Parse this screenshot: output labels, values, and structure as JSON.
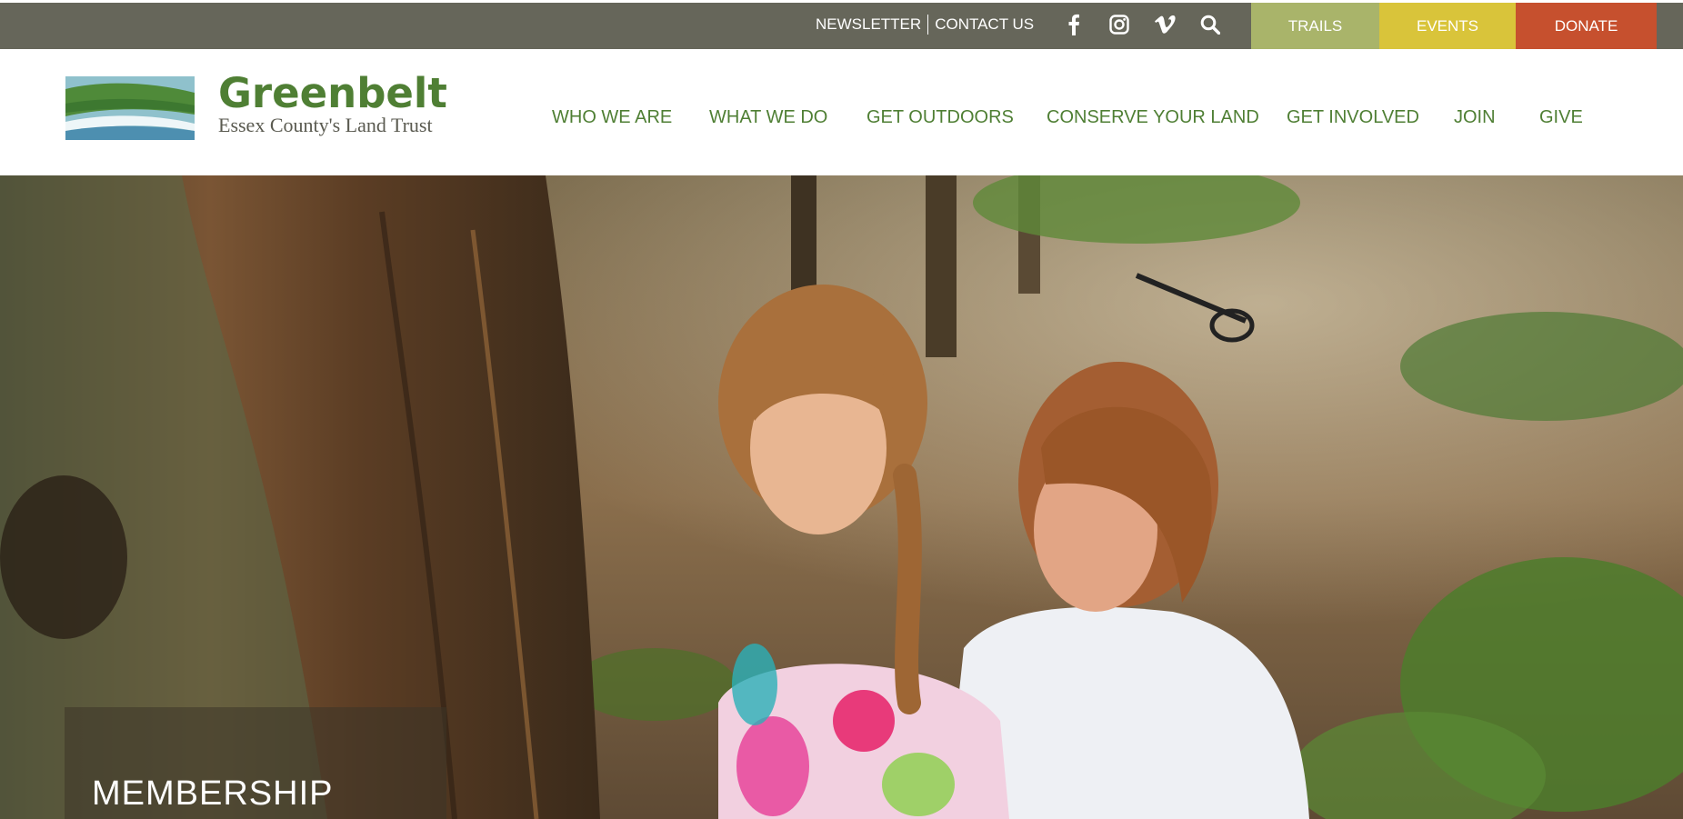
{
  "topbar": {
    "newsletter": "NEWSLETTER",
    "contact": "CONTACT US",
    "social": [
      "facebook-icon",
      "instagram-icon",
      "vimeo-icon",
      "search-icon"
    ],
    "trails": "TRAILS",
    "events": "EVENTS",
    "donate": "DONATE",
    "colors": {
      "bar": "#66665a",
      "trails": "#a9b46a",
      "events": "#d9c43a",
      "donate": "#c6502e"
    }
  },
  "logo": {
    "title": "Greenbelt",
    "subtitle": "Essex County's Land Trust"
  },
  "nav": {
    "items": [
      "WHO WE ARE",
      "WHAT WE DO",
      "GET OUTDOORS",
      "CONSERVE YOUR LAND",
      "GET INVOLVED",
      "JOIN",
      "GIVE"
    ],
    "color": "#4f7f34"
  },
  "hero": {
    "caption": "MEMBERSHIP"
  }
}
